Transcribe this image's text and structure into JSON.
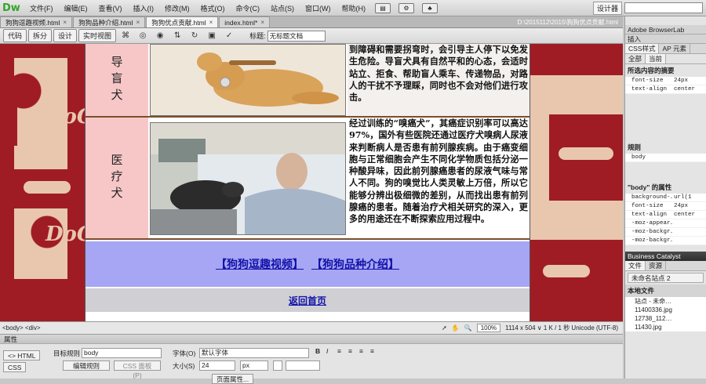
{
  "app": {
    "logo": "Dw"
  },
  "menu": [
    "文件(F)",
    "编辑(E)",
    "查看(V)",
    "插入(I)",
    "修改(M)",
    "格式(O)",
    "命令(C)",
    "站点(S)",
    "窗口(W)",
    "帮助(H)"
  ],
  "workspace": {
    "label": "设计器",
    "search_placeholder": ""
  },
  "tabs": [
    {
      "label": "狗狗逗趣视频.html",
      "active": false
    },
    {
      "label": "狗狗品种介绍.html",
      "active": false
    },
    {
      "label": "狗狗优点贡献.html",
      "active": true
    },
    {
      "label": "index.html*",
      "active": false
    }
  ],
  "file_path": "D:\\2015112\\2015\\狗狗优点贡献.html",
  "doc_toolbar": {
    "views": [
      "代码",
      "拆分",
      "设计",
      "实时视图"
    ],
    "title_label": "标题:",
    "title_value": "无标题文档"
  },
  "page": {
    "row1": {
      "label": "导盲犬",
      "text": "到障碍和需要拐弯时，会引导主人停下以免发生危险。导盲犬具有自然平和的心态，会适时站立、拒食、帮助盲人乘车、传递物品，对路人的干扰不予理睬，同时也不会对他们进行攻击。"
    },
    "row2": {
      "label": "医疗犬",
      "text": "经过训练的“嗅癌犬”，其癌症识别率可以高达97%，国外有些医院还通过医疗犬嗅病人尿液来判断病人是否患有前列腺疾病。由于癌变细胞与正常细胞会产生不同化学物质包括分泌一种酸异味，因此前列腺癌患者的尿液气味与常人不同。狗的嗅觉比人类灵敏上万倍，所以它能够分辨出极细微的差别，从而找出患有前列腺癌的患者。随着治疗犬相关研究的深入，更多的用途还在不断探索应用过程中。"
    },
    "links": [
      "【狗狗逗趣视频】",
      "【狗狗品种介绍】"
    ],
    "home_link": "返回首页"
  },
  "status": {
    "tags": "<body> <div>",
    "zoom": "100%",
    "info": "1114 x 504 ∨ 1 K / 1 秒 Unicode (UTF-8)"
  },
  "properties": {
    "title": "属性",
    "html_label": "<> HTML",
    "css_label": "CSS",
    "target_rule_label": "目标规则",
    "target_rule_value": "body",
    "edit_rule": "编辑规则",
    "css_panel": "CSS 面板(P)",
    "font_label": "字体(O)",
    "font_value": "默认字体",
    "size_label": "大小(S)",
    "size_value": "24",
    "size_unit": "px",
    "page_props": "页面属性..."
  },
  "panel": {
    "browserlab": "Adobe BrowserLab",
    "insert": "插入",
    "css_tabs": [
      "CSS样式",
      "AP 元素"
    ],
    "all_current": [
      "全部",
      "当前"
    ],
    "summary_title": "所选内容的摘要",
    "summary": [
      {
        "k": "font-size",
        "v": "24px"
      },
      {
        "k": "text-align",
        "v": "center"
      }
    ],
    "rules_title": "规则",
    "rules": [
      "body"
    ],
    "props_title": "\"body\" 的属性",
    "props": [
      {
        "k": "background-…",
        "v": "url(1"
      },
      {
        "k": "font-size",
        "v": "24px"
      },
      {
        "k": "text-align",
        "v": "center"
      },
      {
        "k": "-moz-appear…",
        "v": ""
      },
      {
        "k": "-moz-backgr…",
        "v": ""
      },
      {
        "k": "-moz-backgr…",
        "v": ""
      }
    ],
    "business_catalyst": "Business Catalyst",
    "file_tabs": [
      "文件",
      "资源"
    ],
    "site": "未命名站点 2",
    "local_files": "本地文件",
    "files": [
      "站点 - 未命…",
      "11400336.jpg",
      "12738_112…",
      "11430.jpg"
    ]
  }
}
